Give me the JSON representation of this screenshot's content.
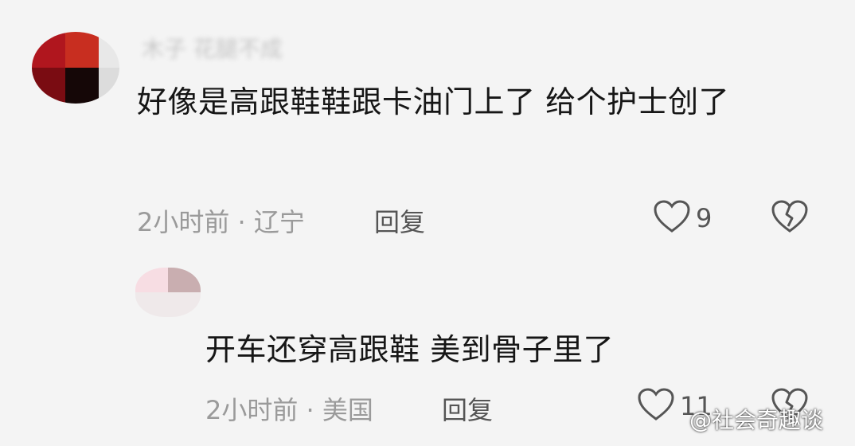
{
  "comments": [
    {
      "username": "木子 花腿不成",
      "text": "好像是高跟鞋鞋跟卡油门上了 给个护士创了",
      "meta": "2小时前 · 辽宁",
      "reply_label": "回复",
      "likes": "9"
    },
    {
      "text": "开车还穿高跟鞋 美到骨子里了",
      "meta": "2小时前 · 美国",
      "reply_label": "回复",
      "likes": "11"
    }
  ],
  "watermark": "@社会奇趣谈",
  "colors": {
    "background": "#f4f4f4",
    "text": "#161616",
    "meta": "#9a9a9a"
  },
  "icons": {
    "like": "heart-outline-icon",
    "dislike": "broken-heart-icon"
  }
}
